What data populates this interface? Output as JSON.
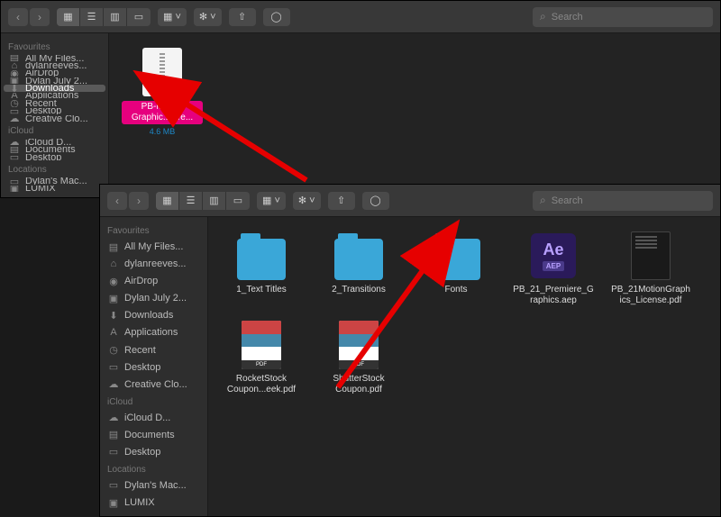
{
  "search_placeholder": "Search",
  "zip_label": "ZIP",
  "aep_label": "Ae",
  "aep_ext": "AEP",
  "pdf_bar": "PDF",
  "window1": {
    "sidebar": {
      "sections": [
        {
          "heading": "Favourites",
          "items": [
            {
              "icon": "▤",
              "label": "All My Files..."
            },
            {
              "icon": "⌂",
              "label": "dylanreeves..."
            },
            {
              "icon": "◉",
              "label": "AirDrop"
            },
            {
              "icon": "▣",
              "label": "Dylan July 2..."
            },
            {
              "icon": "⬇",
              "label": "Downloads",
              "selected": true
            },
            {
              "icon": "A",
              "label": "Applications"
            },
            {
              "icon": "◷",
              "label": "Recent"
            },
            {
              "icon": "▭",
              "label": "Desktop"
            },
            {
              "icon": "☁",
              "label": "Creative Clo..."
            }
          ]
        },
        {
          "heading": "iCloud",
          "items": [
            {
              "icon": "☁",
              "label": "iCloud D..."
            },
            {
              "icon": "▤",
              "label": "Documents"
            },
            {
              "icon": "▭",
              "label": "Desktop"
            }
          ]
        },
        {
          "heading": "Locations",
          "items": [
            {
              "icon": "▭",
              "label": "Dylan's Mac..."
            },
            {
              "icon": "▣",
              "label": "LUMIX"
            }
          ]
        }
      ]
    },
    "files": [
      {
        "type": "zip",
        "name": "PB-Motion Graphic...iere...",
        "meta": "4.6 MB",
        "selected": true
      }
    ]
  },
  "window2": {
    "sidebar": {
      "sections": [
        {
          "heading": "Favourites",
          "items": [
            {
              "icon": "▤",
              "label": "All My Files..."
            },
            {
              "icon": "⌂",
              "label": "dylanreeves..."
            },
            {
              "icon": "◉",
              "label": "AirDrop"
            },
            {
              "icon": "▣",
              "label": "Dylan July 2..."
            },
            {
              "icon": "⬇",
              "label": "Downloads"
            },
            {
              "icon": "A",
              "label": "Applications"
            },
            {
              "icon": "◷",
              "label": "Recent"
            },
            {
              "icon": "▭",
              "label": "Desktop"
            },
            {
              "icon": "☁",
              "label": "Creative Clo..."
            }
          ]
        },
        {
          "heading": "iCloud",
          "items": [
            {
              "icon": "☁",
              "label": "iCloud D..."
            },
            {
              "icon": "▤",
              "label": "Documents"
            },
            {
              "icon": "▭",
              "label": "Desktop"
            }
          ]
        },
        {
          "heading": "Locations",
          "items": [
            {
              "icon": "▭",
              "label": "Dylan's Mac..."
            },
            {
              "icon": "▣",
              "label": "LUMIX"
            }
          ]
        }
      ]
    },
    "files": [
      {
        "type": "folder",
        "name": "1_Text Titles"
      },
      {
        "type": "folder",
        "name": "2_Transitions"
      },
      {
        "type": "folder",
        "name": "Fonts"
      },
      {
        "type": "aep",
        "name": "PB_21_Premiere_Graphics.aep"
      },
      {
        "type": "pdf",
        "name": "PB_21MotionGraphics_License.pdf"
      },
      {
        "type": "thumb",
        "name": "RocketStock Coupon...eek.pdf"
      },
      {
        "type": "thumb",
        "name": "ShutterStock Coupon.pdf"
      }
    ]
  }
}
